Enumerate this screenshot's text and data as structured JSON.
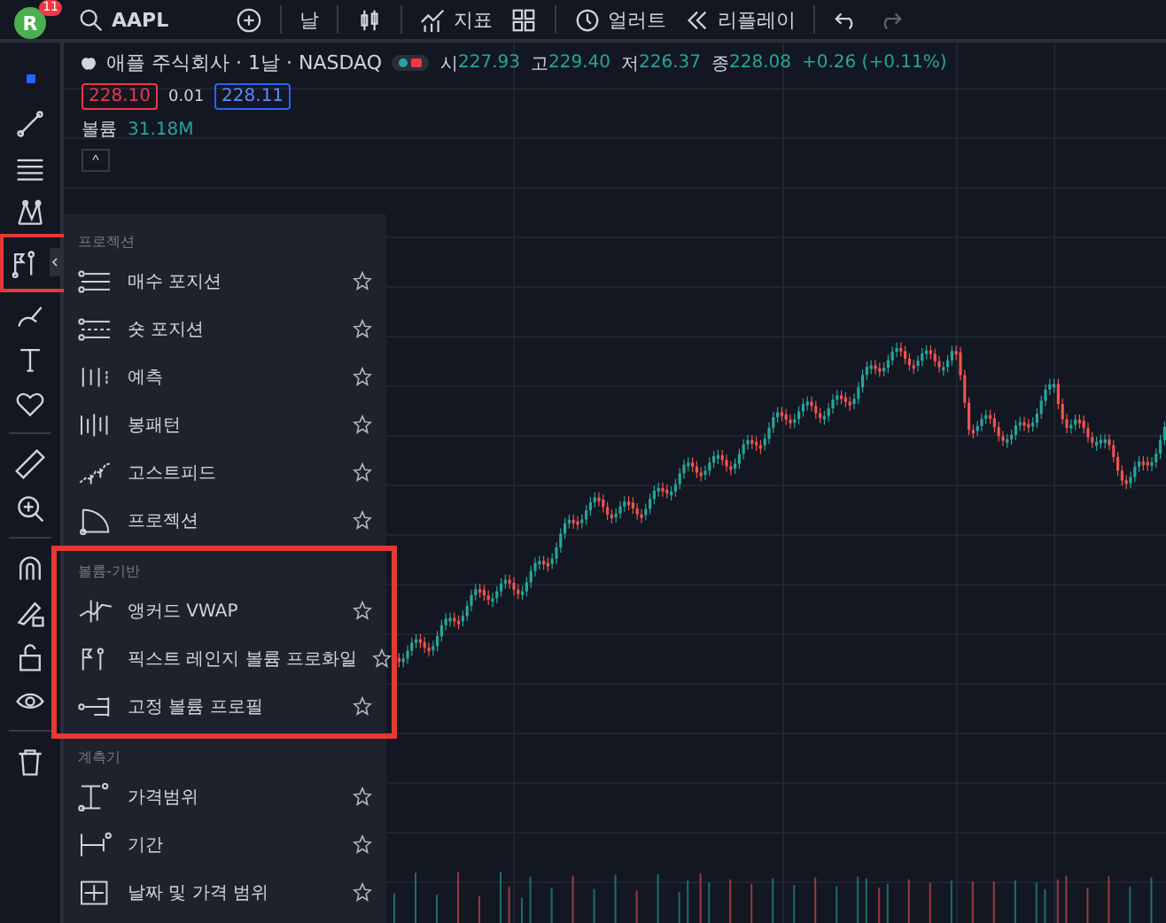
{
  "top_bar": {
    "avatar": "R",
    "notifications": "11",
    "symbol": "AAPL",
    "interval": "날",
    "indicators": "지표",
    "alerts": "얼러트",
    "replay": "리플레이"
  },
  "legend": {
    "title": "애플 주식회사 · 1날 · NASDAQ",
    "ohlc": [
      {
        "label": "시",
        "value": "227.93"
      },
      {
        "label": "고",
        "value": "229.40"
      },
      {
        "label": "저",
        "value": "226.37"
      },
      {
        "label": "종",
        "value": "228.08"
      }
    ],
    "change": "+0.26 (+0.11%)",
    "bid": "228.10",
    "spread": "0.01",
    "ask": "228.11",
    "volume_label": "볼륨",
    "volume": "31.18M",
    "collapse": "^"
  },
  "tool_groups": [
    {
      "tools": [
        {
          "kind": "cursor",
          "selected": false
        },
        {
          "kind": "trendline",
          "selected": false
        },
        {
          "kind": "fib",
          "selected": false
        },
        {
          "kind": "pattern",
          "selected": false
        },
        {
          "kind": "projection",
          "selected": true
        },
        {
          "kind": "brush",
          "selected": false
        },
        {
          "kind": "text",
          "selected": false
        },
        {
          "kind": "heart",
          "selected": false
        }
      ]
    },
    {
      "tools": [
        {
          "kind": "ruler",
          "selected": false
        },
        {
          "kind": "zoom",
          "selected": false
        }
      ]
    },
    {
      "tools": [
        {
          "kind": "magnet",
          "selected": false
        },
        {
          "kind": "pencil-lock",
          "selected": false
        },
        {
          "kind": "lock",
          "selected": false
        },
        {
          "kind": "eye",
          "selected": false
        }
      ]
    },
    {
      "tools": [
        {
          "kind": "trash",
          "selected": false
        }
      ]
    }
  ],
  "menu": {
    "sections": [
      {
        "title": "프로젝션",
        "highlighted": false,
        "items": [
          {
            "label": "매수 포지션",
            "kind": "long",
            "favorite": false
          },
          {
            "label": "숏 포지션",
            "kind": "short",
            "favorite": false
          },
          {
            "label": "예측",
            "kind": "forecast",
            "favorite": false
          },
          {
            "label": "봉패턴",
            "kind": "bars",
            "favorite": false
          },
          {
            "label": "고스트피드",
            "kind": "ghost",
            "favorite": false
          },
          {
            "label": "프로젝션",
            "kind": "arc",
            "favorite": false
          }
        ]
      },
      {
        "title": "볼륨-기반",
        "highlighted": true,
        "items": [
          {
            "label": "앵커드 VWAP",
            "kind": "vwap",
            "favorite": false
          },
          {
            "label": "픽스트 레인지 볼륨 프로화일",
            "kind": "frvp",
            "favorite": false
          },
          {
            "label": "고정 볼륨 프로필",
            "kind": "fixed",
            "favorite": false
          }
        ]
      },
      {
        "title": "계측기",
        "highlighted": false,
        "items": [
          {
            "label": "가격범위",
            "kind": "price-range",
            "favorite": false
          },
          {
            "label": "기간",
            "kind": "date-range",
            "favorite": false
          },
          {
            "label": "날짜 및 가격 범위",
            "kind": "date-price",
            "favorite": false
          }
        ]
      }
    ]
  }
}
